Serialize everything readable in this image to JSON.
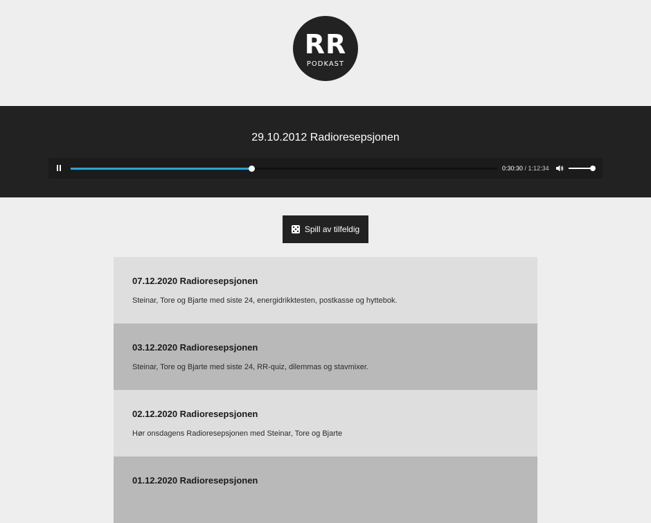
{
  "logo": {
    "initials": "RR",
    "subtitle": "PODKAST"
  },
  "player": {
    "episode_title": "29.10.2012 Radioresepsjonen",
    "current_time": "0:30:30",
    "separator": " / ",
    "duration": "1:12:34",
    "progress_fraction": 0.424,
    "volume_fraction": 0.93,
    "state": "playing",
    "accent_color": "#1aabe5"
  },
  "random_button": {
    "label": "Spill av tilfeldig",
    "icon": "dice-icon"
  },
  "episodes": [
    {
      "title": "07.12.2020 Radioresepsjonen",
      "description": "Steinar, Tore og Bjarte med siste 24, energidrikktesten, postkasse og hyttebok."
    },
    {
      "title": "03.12.2020 Radioresepsjonen",
      "description": "Steinar, Tore og Bjarte med siste 24, RR-quiz, dilemmas og stavmixer."
    },
    {
      "title": "02.12.2020 Radioresepsjonen",
      "description": "Hør onsdagens Radioresepsjonen med Steinar, Tore og Bjarte"
    },
    {
      "title": "01.12.2020 Radioresepsjonen",
      "description": ""
    }
  ]
}
